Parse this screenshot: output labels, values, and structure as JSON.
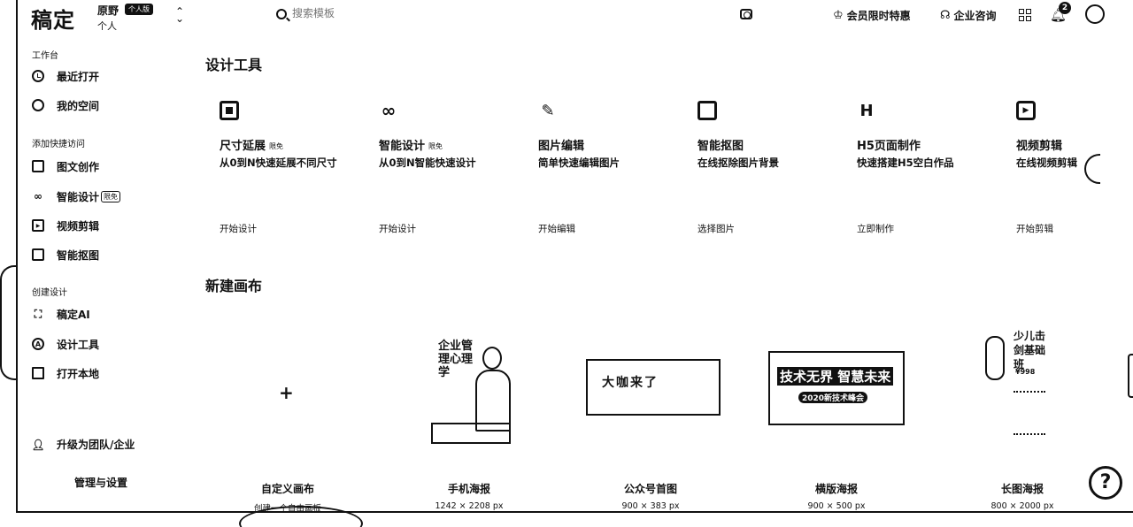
{
  "header": {
    "logo": "稿定",
    "team_name": "原野",
    "team_badge": "个人版",
    "team_sub": "个人",
    "switch_icon": "chevron-updown-icon",
    "search_placeholder": "搜索模板",
    "vip_label": "会员限时特惠",
    "enterprise_label": "企业咨询",
    "notification_count": "2"
  },
  "sidebar": {
    "workspace_title": "工作台",
    "workspace_items": [
      {
        "label": "最近打开",
        "icon": "clock-icon"
      },
      {
        "label": "我的空间",
        "icon": "user-icon"
      }
    ],
    "quick_title": "添加快捷访问",
    "quick_items": [
      {
        "label": "图文创作",
        "icon": "document-icon"
      },
      {
        "label": "智能设计",
        "icon": "link-icon",
        "badge": "限免"
      },
      {
        "label": "视频剪辑",
        "icon": "play-icon"
      },
      {
        "label": "智能抠图",
        "icon": "cutout-icon"
      }
    ],
    "create_title": "创建设计",
    "create_items": [
      {
        "label": "稿定AI",
        "icon": "ai-scan-icon"
      },
      {
        "label": "设计工具",
        "icon": "compass-icon"
      },
      {
        "label": "打开本地",
        "icon": "folder-icon"
      }
    ],
    "upgrade_label": "升级为团队/企业",
    "manage_label": "管理与设置"
  },
  "main": {
    "tools_title": "设计工具",
    "tools": [
      {
        "name": "尺寸延展",
        "badge": "限免",
        "desc": "从0到N快速延展不同尺寸",
        "action": "开始设计",
        "icon": "resize-icon"
      },
      {
        "name": "智能设计",
        "badge": "限免",
        "desc": "从0到N智能快速设计",
        "action": "开始设计",
        "icon": "smart-link-icon"
      },
      {
        "name": "图片编辑",
        "badge": "",
        "desc": "简单快速编辑图片",
        "action": "开始编辑",
        "icon": "image-edit-icon"
      },
      {
        "name": "智能抠图",
        "badge": "",
        "desc": "在线抠除图片背景",
        "action": "选择图片",
        "icon": "cutout-icon"
      },
      {
        "name": "H5页面制作",
        "badge": "",
        "desc": "快速搭建H5空白作品",
        "action": "立即制作",
        "icon": "h5-icon"
      },
      {
        "name": "视频剪辑",
        "badge": "",
        "desc": "在线视频剪辑",
        "action": "开始剪辑",
        "icon": "video-play-icon"
      }
    ],
    "canvas_title": "新建画布",
    "canvases": [
      {
        "name": "自定义画布",
        "size": "创建一个自由画板"
      },
      {
        "name": "手机海报",
        "size": "1242 × 2208 px"
      },
      {
        "name": "公众号首图",
        "size": "900 × 383 px"
      },
      {
        "name": "横版海报",
        "size": "900 × 500 px"
      },
      {
        "name": "长图海报",
        "size": "800 × 2000 px"
      }
    ],
    "thumbs": {
      "phone_title": "企业管理心理学",
      "wx_text": "大咖来了",
      "land_line1": "技术无界 智慧未来",
      "land_line2": "2020新技术峰会",
      "long_title": "少儿击剑基础班",
      "long_price": "¥998"
    }
  },
  "help_label": "?"
}
